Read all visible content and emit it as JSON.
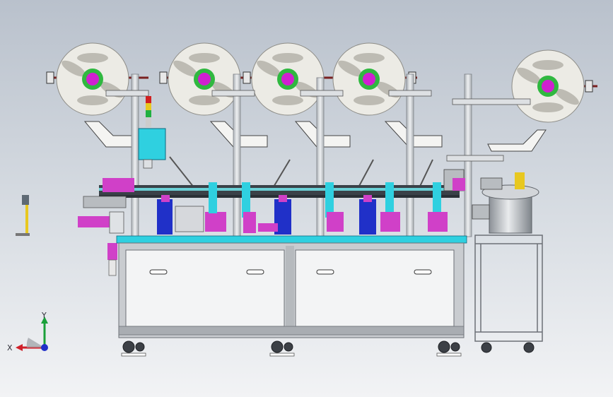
{
  "viewport": {
    "background_top": "#b9c1cc",
    "background_bottom": "#f2f3f5"
  },
  "axis_triad": {
    "x_label": "X",
    "y_label": "Y",
    "x_color": "#d0202a",
    "y_color": "#1aa03a",
    "z_color": "#2030c8"
  },
  "machine": {
    "reel_count": 5,
    "station_count": 5,
    "colors": {
      "reel": "#ecebe5",
      "hub": "#d020d0",
      "hub_ring": "#30b840",
      "column": "#d9dde0",
      "frame": "#c9ccd0",
      "accent_cyan": "#2fd0e0",
      "accent_magenta": "#d040c8",
      "accent_blue": "#2030c8",
      "dark_rail": "#3a4148"
    }
  }
}
